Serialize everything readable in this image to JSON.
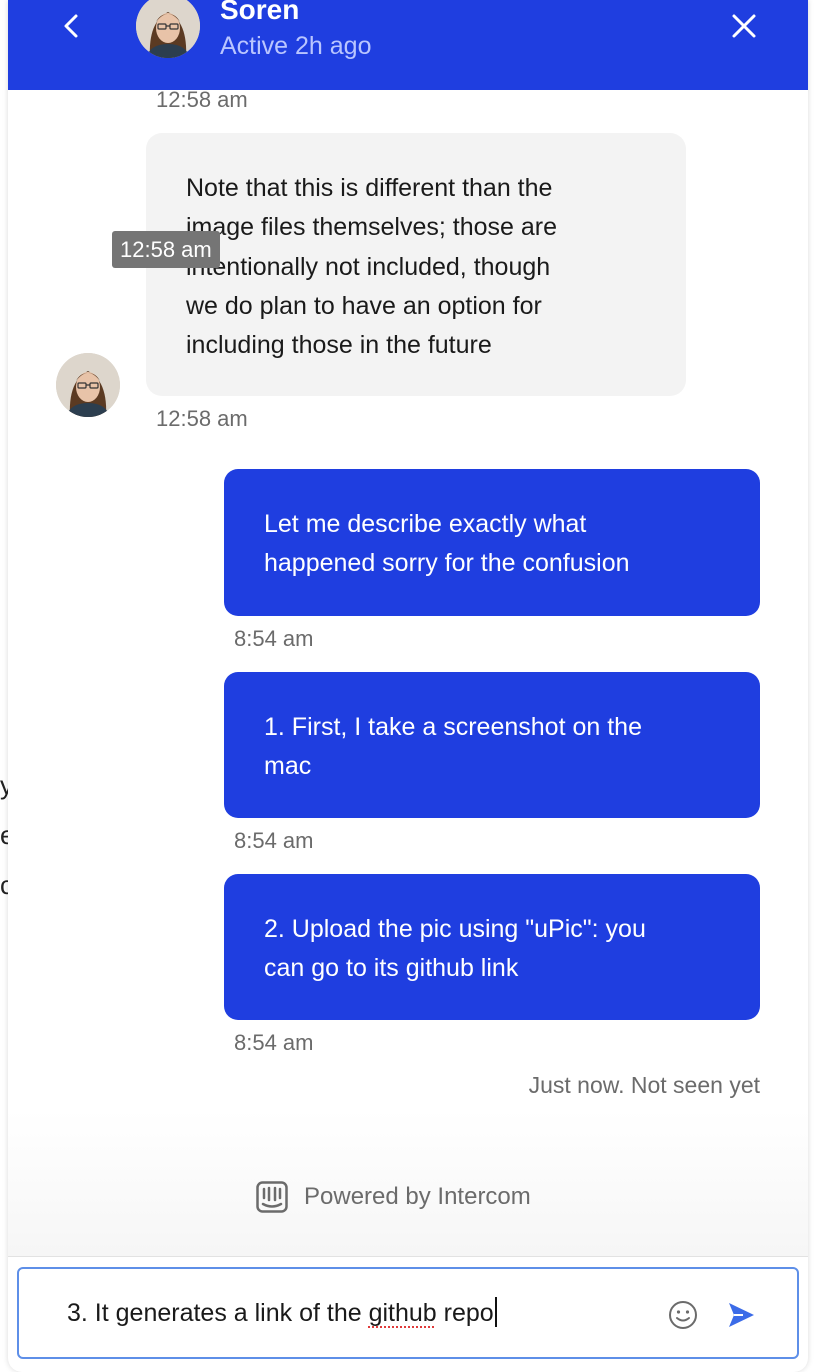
{
  "header": {
    "name": "Soren",
    "status": "Active 2h ago"
  },
  "background_fragments": [
    "y",
    "e",
    "c"
  ],
  "messages": {
    "incoming": {
      "top_timestamp": "12:58 am",
      "hover_timestamp": "12:58 am",
      "lines": [
        "Note that this is different than the",
        "image files themselves; those are",
        "intentionally not included, though",
        "we do plan to have an option for",
        "including those in the future"
      ],
      "timestamp": "12:58 am"
    },
    "outgoing": [
      {
        "lines": [
          "Let me describe exactly what",
          "happened sorry for the confusion"
        ],
        "timestamp": "8:54 am"
      },
      {
        "lines": [
          "1. First, I take a screenshot on the",
          "mac"
        ],
        "timestamp": "8:54 am"
      },
      {
        "lines": [
          "2. Upload the pic using \"uPic\": you",
          "can go to its github link"
        ],
        "timestamp": "8:54 am"
      }
    ],
    "seen_status": "Just now. Not seen yet"
  },
  "footer": {
    "powered_by": "Powered by Intercom"
  },
  "composer": {
    "text_before": "3. It generates a link of the ",
    "text_misspelled": "github",
    "text_after": " repo"
  },
  "colors": {
    "brand_blue": "#1f3ee0",
    "incoming_bubble": "#f3f3f3",
    "timestamp_grey": "#6b6b6b"
  },
  "icons": [
    "chevron-left-icon",
    "close-icon",
    "intercom-logo-icon",
    "smiley-icon",
    "send-icon"
  ]
}
